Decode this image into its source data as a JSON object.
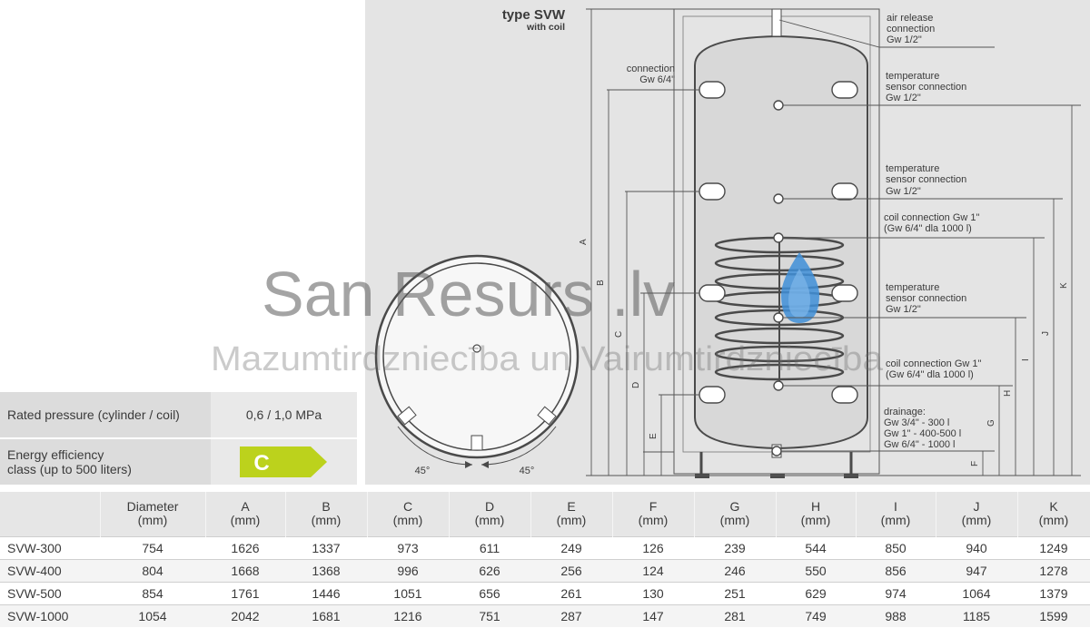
{
  "diagram": {
    "title": "type SVW",
    "subtitle": "with coil",
    "left_connection_label": [
      "connection",
      "Gw 6/4\""
    ],
    "annotations": [
      [
        "air release",
        "connection",
        "Gw 1/2\""
      ],
      [
        "temperature",
        "sensor connection",
        "Gw 1/2\""
      ],
      [
        "temperature",
        "sensor connection",
        "Gw 1/2\""
      ],
      [
        "coil connection Gw 1\"",
        "(Gw 6/4\" dla 1000 l)"
      ],
      [
        "temperature",
        "sensor connection",
        "Gw 1/2\""
      ],
      [
        "coil connection Gw 1\"",
        "(Gw 6/4\" dla 1000 l)"
      ],
      [
        "drainage:",
        "Gw 3/4\" - 300 l",
        "Gw 1\" - 400-500 l",
        "Gw 6/4\" - 1000 l"
      ]
    ],
    "dimension_letters_left": [
      "A",
      "B",
      "C",
      "D",
      "E",
      "F"
    ],
    "dimension_letters_right": [
      "G",
      "H",
      "I",
      "J",
      "K"
    ],
    "angles": [
      "45°",
      "45°"
    ],
    "colors": {
      "background": "#e4e4e4",
      "tank": "#d8d8d8",
      "water_drop": "#3f8fd8"
    }
  },
  "watermark": {
    "line1": "San Resurs .lv",
    "line2": "Mazumtirdzniecība un Vairumtirdzniecība"
  },
  "specs": {
    "pressure_label": "Rated pressure (cylinder / coil)",
    "pressure_value": "0,6 / 1,0 MPa",
    "energy_label_1": "Energy efficiency",
    "energy_label_2": "class (up to 500 liters)",
    "energy_class": "C",
    "energy_color": "#bcd21c"
  },
  "table": {
    "headers": [
      [
        "",
        ""
      ],
      [
        "Diameter",
        "(mm)"
      ],
      [
        "A",
        "(mm)"
      ],
      [
        "B",
        "(mm)"
      ],
      [
        "C",
        "(mm)"
      ],
      [
        "D",
        "(mm)"
      ],
      [
        "E",
        "(mm)"
      ],
      [
        "F",
        "(mm)"
      ],
      [
        "G",
        "(mm)"
      ],
      [
        "H",
        "(mm)"
      ],
      [
        "I",
        "(mm)"
      ],
      [
        "J",
        "(mm)"
      ],
      [
        "K",
        "(mm)"
      ]
    ],
    "rows": [
      [
        "SVW-300",
        "754",
        "1626",
        "1337",
        "973",
        "611",
        "249",
        "126",
        "239",
        "544",
        "850",
        "940",
        "1249"
      ],
      [
        "SVW-400",
        "804",
        "1668",
        "1368",
        "996",
        "626",
        "256",
        "124",
        "246",
        "550",
        "856",
        "947",
        "1278"
      ],
      [
        "SVW-500",
        "854",
        "1761",
        "1446",
        "1051",
        "656",
        "261",
        "130",
        "251",
        "629",
        "974",
        "1064",
        "1379"
      ],
      [
        "SVW-1000",
        "1054",
        "2042",
        "1681",
        "1216",
        "751",
        "287",
        "147",
        "281",
        "749",
        "988",
        "1185",
        "1599"
      ]
    ]
  }
}
